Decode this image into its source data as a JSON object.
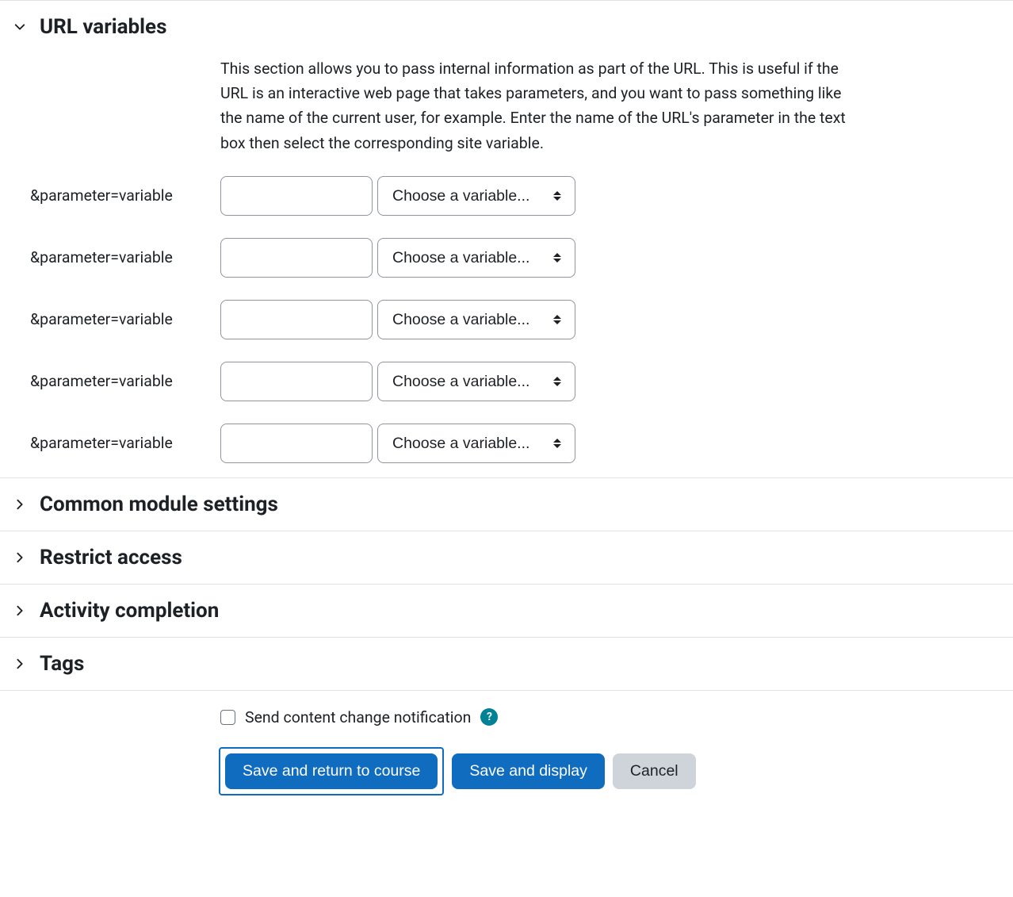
{
  "sections": {
    "url_variables": {
      "title": "URL variables",
      "expanded": true,
      "description": "This section allows you to pass internal information as part of the URL. This is useful if the URL is an interactive web page that takes parameters, and you want to pass something like the name of the current user, for example. Enter the name of the URL's parameter in the text box then select the corresponding site variable.",
      "rows": [
        {
          "label": "&parameter=variable",
          "param_value": "",
          "select_placeholder": "Choose a variable..."
        },
        {
          "label": "&parameter=variable",
          "param_value": "",
          "select_placeholder": "Choose a variable..."
        },
        {
          "label": "&parameter=variable",
          "param_value": "",
          "select_placeholder": "Choose a variable..."
        },
        {
          "label": "&parameter=variable",
          "param_value": "",
          "select_placeholder": "Choose a variable..."
        },
        {
          "label": "&parameter=variable",
          "param_value": "",
          "select_placeholder": "Choose a variable..."
        }
      ]
    },
    "common_module": {
      "title": "Common module settings",
      "expanded": false
    },
    "restrict_access": {
      "title": "Restrict access",
      "expanded": false
    },
    "activity_completion": {
      "title": "Activity completion",
      "expanded": false
    },
    "tags": {
      "title": "Tags",
      "expanded": false
    }
  },
  "footer": {
    "notify_label": "Send content change notification",
    "notify_checked": false,
    "help_symbol": "?",
    "save_return_label": "Save and return to course",
    "save_display_label": "Save and display",
    "cancel_label": "Cancel"
  }
}
